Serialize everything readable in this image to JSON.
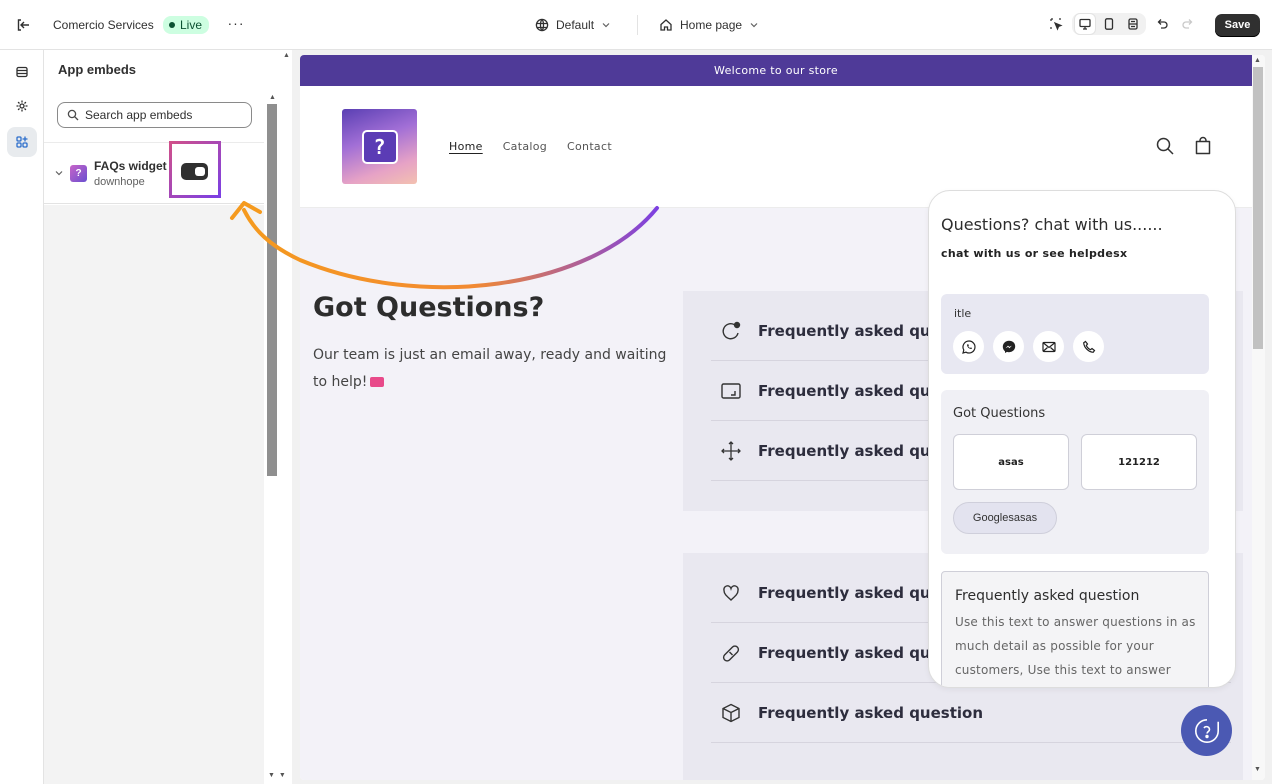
{
  "topbar": {
    "store_name": "Comercio Services",
    "status_badge": "Live",
    "more_label": "···",
    "theme_label": "Default",
    "page_label": "Home page",
    "save_label": "Save"
  },
  "sidebar": {
    "title": "App embeds",
    "search_placeholder": "Search app embeds",
    "embed": {
      "name": "FAQs widget",
      "developer": "downhope",
      "enabled": true
    }
  },
  "store": {
    "announcement": "Welcome to our store",
    "nav": [
      "Home",
      "Catalog",
      "Contact"
    ],
    "heading": "Got Questions?",
    "intro": "Our team is just an email away, ready and waiting to help!",
    "faq_items": [
      {
        "icon": "chat-bubble-icon",
        "text": "Frequently asked ques"
      },
      {
        "icon": "dimensions-icon",
        "text": "Frequently asked ques"
      },
      {
        "icon": "move-arrows-icon",
        "text": "Frequently asked ques"
      },
      {
        "icon": "heart-icon",
        "text": "Frequently asked ques"
      },
      {
        "icon": "bandage-icon",
        "text": "Frequently asked ques"
      },
      {
        "icon": "box-icon",
        "text": "Frequently asked question"
      }
    ]
  },
  "widget": {
    "title": "Questions? chat with us......",
    "subtitle": "chat with us or see helpdesx",
    "contact_card_label": "itle",
    "contacts": [
      "whatsapp-icon",
      "messenger-icon",
      "email-icon",
      "phone-icon"
    ],
    "questions_label": "Got Questions",
    "tiles": [
      "asas",
      "121212"
    ],
    "pill": "Googlesasas",
    "faq_heading": "Frequently asked question",
    "faq_body": "Use this text to answer questions in as much detail as possible for your customers, Use this text to answer questions in as much detail as possible"
  },
  "colors": {
    "announcement_bg": "#4f3a98",
    "fab_bg": "#4b59b3",
    "arrow_start": "#f59a1e",
    "arrow_end": "#7b3fe4",
    "live_badge": "#cdfee1"
  }
}
